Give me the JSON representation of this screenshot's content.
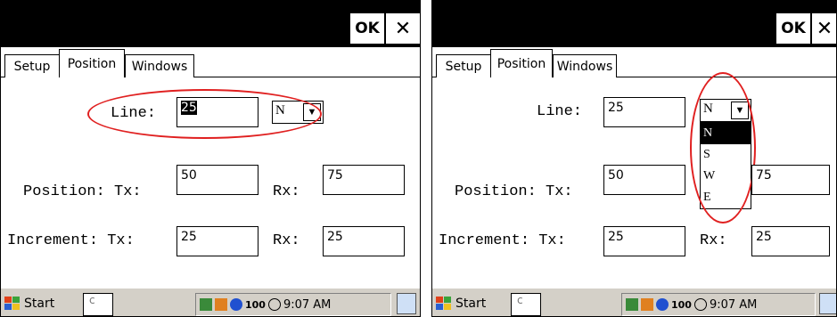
{
  "title_bar": {
    "ok_label": "OK",
    "close_label": "✕"
  },
  "tabs": [
    "Setup",
    "Position",
    "Windows"
  ],
  "form": {
    "line_label": "Line:",
    "line_value": "25",
    "direction_value": "N",
    "position_label": "Position: Tx:",
    "position_tx": "50",
    "position_rx_label": "Rx:",
    "position_rx": "75",
    "increment_label": "Increment: Tx:",
    "increment_tx": "25",
    "increment_rx_label": "Rx:",
    "increment_rx": "25"
  },
  "dropdown_options": [
    "N",
    "S",
    "W",
    "E"
  ],
  "left_combo_partial": "N",
  "taskbar": {
    "start_label": "Start",
    "box_text": "c",
    "clock": "9:07 AM",
    "battery_text": "100"
  },
  "colors": {
    "highlight": "#e02020",
    "titlebar": "#000000",
    "taskbar": "#d4d0c8"
  }
}
